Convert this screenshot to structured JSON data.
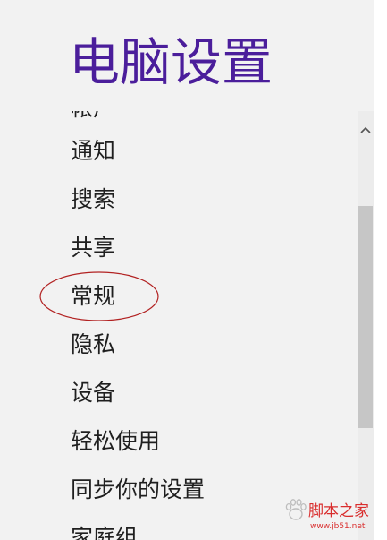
{
  "page": {
    "title": "电脑设置"
  },
  "nav": {
    "items": [
      {
        "label": "帐户"
      },
      {
        "label": "通知"
      },
      {
        "label": "搜索"
      },
      {
        "label": "共享"
      },
      {
        "label": "常规"
      },
      {
        "label": "隐私"
      },
      {
        "label": "设备"
      },
      {
        "label": "轻松使用"
      },
      {
        "label": "同步你的设置"
      },
      {
        "label": "家庭组"
      }
    ]
  },
  "annotation": {
    "highlighted_item": "常规",
    "shape": "ellipse",
    "color": "#b22222"
  },
  "watermark": {
    "brand": "脚本之家",
    "url": "www.jb51.net",
    "logo": "baidu-paw-logo"
  },
  "colors": {
    "title": "#4b1e9b",
    "background": "#f2f2f2",
    "text": "#1f1f1f",
    "scroll_thumb": "#c6c6c6"
  }
}
